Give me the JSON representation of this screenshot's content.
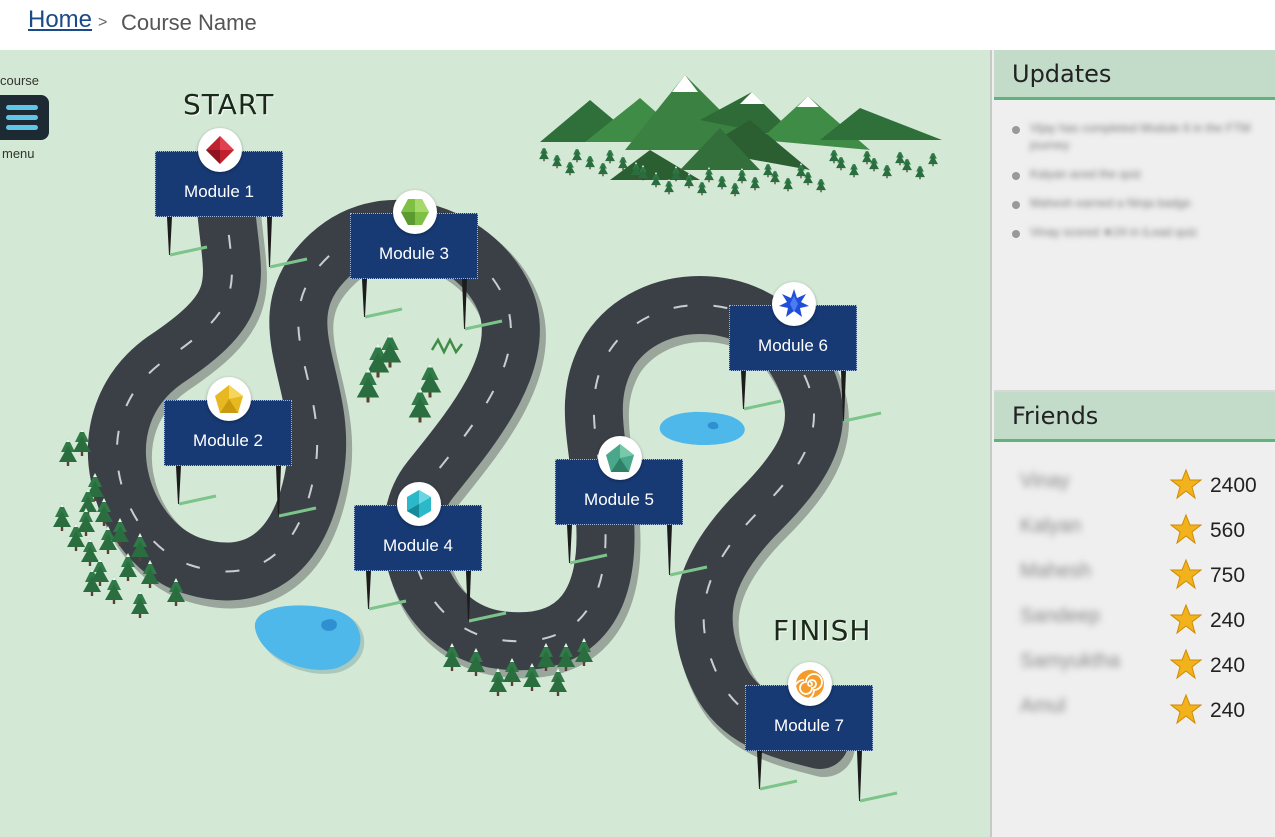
{
  "breadcrumb": {
    "home": "Home",
    "separator": ">",
    "current": "Course Name"
  },
  "menu": {
    "top_label": "course",
    "bottom_label": "menu",
    "icon": "hamburger-icon"
  },
  "map": {
    "start_label": "START",
    "finish_label": "FINISH",
    "modules": [
      {
        "label": "Module 1",
        "badge_icon": "red-diamond-gem-icon"
      },
      {
        "label": "Module 2",
        "badge_icon": "yellow-pentagon-gem-icon"
      },
      {
        "label": "Module 3",
        "badge_icon": "green-hexagon-gem-icon"
      },
      {
        "label": "Module 4",
        "badge_icon": "cyan-hexagon-gem-icon"
      },
      {
        "label": "Module 5",
        "badge_icon": "teal-pentagon-gem-icon"
      },
      {
        "label": "Module 6",
        "badge_icon": "blue-star-icon"
      },
      {
        "label": "Module 7",
        "badge_icon": "orange-swirl-icon"
      }
    ]
  },
  "updates": {
    "title": "Updates",
    "items": [
      "Vijay has completed Module 6 in the FTM journey",
      "Kalyan aced the quiz",
      "Mahesh earned a Ninja badge",
      "Vinay scored ★24 in iLead quiz"
    ]
  },
  "friends": {
    "title": "Friends",
    "items": [
      {
        "name": "Vinay",
        "score": "2400"
      },
      {
        "name": "Kalyan",
        "score": "560"
      },
      {
        "name": "Mahesh",
        "score": "750"
      },
      {
        "name": "Sandeep",
        "score": "240"
      },
      {
        "name": "Samyuktha",
        "score": "240"
      },
      {
        "name": "Amul",
        "score": "240"
      }
    ]
  },
  "colors": {
    "map_bg": "#d4e9d5",
    "road": "#3b4047",
    "module_bg": "#173a75",
    "panel_head": "#c2dcc9",
    "accent": "#5fb37b"
  }
}
